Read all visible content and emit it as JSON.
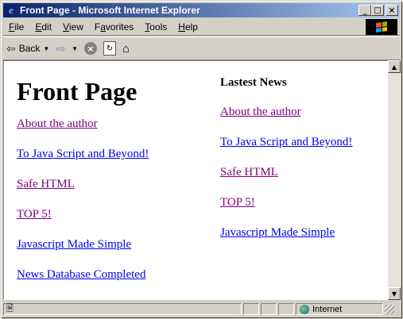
{
  "window": {
    "title": "Front Page - Microsoft Internet Explorer",
    "controls": {
      "minimize": "_",
      "maximize": "□",
      "close": "×"
    }
  },
  "menu": [
    {
      "label": "File",
      "key": "F"
    },
    {
      "label": "Edit",
      "key": "E"
    },
    {
      "label": "View",
      "key": "V"
    },
    {
      "label": "Favorites",
      "key": "a"
    },
    {
      "label": "Tools",
      "key": "T"
    },
    {
      "label": "Help",
      "key": "H"
    }
  ],
  "toolbar": {
    "back_label": "Back",
    "icons": [
      "back-arrow-icon",
      "forward-arrow-icon",
      "stop-icon",
      "refresh-icon",
      "home-icon"
    ]
  },
  "page": {
    "title": "Front Page",
    "left_links": [
      {
        "text": "About the author",
        "visited": true
      },
      {
        "text": "To Java Script and Beyond!",
        "visited": false
      },
      {
        "text": "Safe HTML",
        "visited": true
      },
      {
        "text": "TOP 5!",
        "visited": true
      },
      {
        "text": "Javascript Made Simple",
        "visited": false
      },
      {
        "text": "News Database Completed",
        "visited": false
      }
    ],
    "news_heading": "Lastest News",
    "news_links": [
      {
        "text": "About the author",
        "visited": true
      },
      {
        "text": "To Java Script and Beyond!",
        "visited": false
      },
      {
        "text": "Safe HTML",
        "visited": true
      },
      {
        "text": "TOP 5!",
        "visited": true
      },
      {
        "text": "Javascript Made Simple",
        "visited": false
      }
    ]
  },
  "status": {
    "zone": "Internet"
  },
  "colors": {
    "title_start": "#0a246a",
    "title_end": "#a6caf0",
    "link": "#0000ee",
    "visited": "#800080"
  }
}
